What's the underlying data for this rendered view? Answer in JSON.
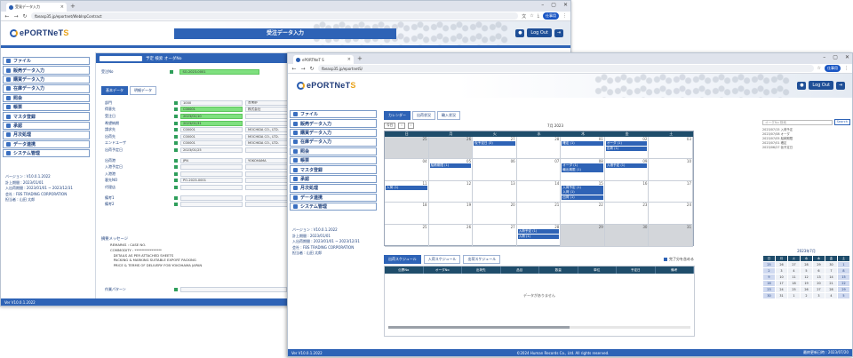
{
  "browser": {
    "tab1_title": "受発データ入力",
    "tab2_title": "ePORTNeT S",
    "url1": "fbeasp35.jp/eportnet/WebInpContract",
    "url2": "fbeasp35.jp/eportnetS/",
    "profile": "仕事用"
  },
  "brand": {
    "logo_main": "ePORTNeT",
    "logo_s": "S"
  },
  "window1": {
    "page_title": "受注データ入力",
    "logout": "Log Out",
    "sidebar": [
      "ファイル",
      "販売データ入力",
      "購買データ入力",
      "在庫データ入力",
      "照会",
      "帳票",
      "マスタ登録",
      "承認",
      "月次処理",
      "データ連携",
      "システム管理"
    ],
    "sidebar_info": [
      "バージョン : V10.0.1.2022",
      "計上期間 : 2023/01/01",
      "入出荷期間 : 2023/01/01 ~ 2023/12/31",
      "会社 : FBS TRADING CORPORATION",
      "担当者 : 山田 太郎"
    ],
    "search_bar": "予定  検索  オーダNo",
    "subtabs": [
      "基本データ",
      "明細データ"
    ],
    "order_label": "受注No",
    "order_value": "SO-2023-0001",
    "fields": [
      {
        "label": "部門",
        "value": "1000",
        "extra": "営業部"
      },
      {
        "label": "得意先",
        "value": "C00001",
        "extra": "株式会社"
      },
      {
        "label": "受注日",
        "value": "2023/01/10",
        "extra": ""
      },
      {
        "label": "希望納期",
        "value": "2023/01/31",
        "extra": ""
      },
      {
        "label": "請求先",
        "value": "C00001",
        "extra": "MOCHIDA CO., LTD."
      },
      {
        "label": "出荷先",
        "value": "C00001",
        "extra": "MOCHIDA CO., LTD."
      },
      {
        "label": "エンドユーザ",
        "value": "C00001",
        "extra": "MOCHIDA CO., LTD."
      },
      {
        "label": "出荷予定日",
        "value": "2023/01/25",
        "extra": ""
      },
      {
        "label": "出荷港",
        "value": "JPN",
        "extra": "YOKOHAMA"
      },
      {
        "label": "入港予定日",
        "value": "",
        "extra": ""
      },
      {
        "label": "入港港",
        "value": "",
        "extra": ""
      },
      {
        "label": "客先NO",
        "value": "PO-2023-0001",
        "extra": ""
      },
      {
        "label": "代理店",
        "value": "",
        "extra": ""
      },
      {
        "label": "備考1",
        "value": "",
        "extra": ""
      },
      {
        "label": "備考2",
        "value": "",
        "extra": ""
      }
    ],
    "remarks_label": "摘要メッセージ",
    "remarks": "REMARKS : CASE NO.\nCOMMODITY : ****************\n   DETAILS AS PER ATTACHED SHEETS\n   PACKING & MARKING SUITABLE EXPORT PACKING\n   PRICE & TERMS OF DELIVERY FOB YOKOHAMA JAPAN",
    "work_pattern": "作業パターン",
    "footer_left": "Ver V10.0.1.2022",
    "footer_right": "©2024 Human Records Co., Ltd. All rights reserved."
  },
  "window2": {
    "logout": "Log Out",
    "sidebar": [
      "ファイル",
      "販売データ入力",
      "購買データ入力",
      "在庫データ入力",
      "照会",
      "帳票",
      "マスタ登録",
      "承認",
      "月次処理",
      "データ連携",
      "システム管理"
    ],
    "sidebar_info": [
      "バージョン : V10.0.1.2022",
      "計上期間 : 2023/01/01",
      "入出荷期間 : 2023/01/01 ~ 2023/12/31",
      "会社 : FBS TRADING CORPORATION",
      "担当者 : 山田 太郎"
    ],
    "cal_tabs": [
      "カレンダー",
      "出荷状況",
      "輸入状況"
    ],
    "month_label": "7月 2023",
    "today_btn": "今日",
    "weekdays": [
      "日",
      "月",
      "火",
      "水",
      "木",
      "金",
      "土"
    ],
    "cells": [
      {
        "d": "25",
        "grey": true,
        "ev": []
      },
      {
        "d": "26",
        "grey": true,
        "ev": []
      },
      {
        "d": "27",
        "grey": false,
        "ev": [
          "仮予定日 (3)"
        ]
      },
      {
        "d": "28",
        "grey": false,
        "ev": []
      },
      {
        "d": "01",
        "grey": false,
        "ev": [
          "確定 (1)"
        ]
      },
      {
        "d": "02",
        "grey": false,
        "ev": [
          "オーダ (1)",
          "出荷 (1)"
        ]
      },
      {
        "d": "03",
        "grey": false,
        "ev": []
      },
      {
        "d": "04",
        "grey": false,
        "ev": []
      },
      {
        "d": "05",
        "grey": false,
        "ev": [
          "船積期限 (1)"
        ]
      },
      {
        "d": "06",
        "grey": false,
        "ev": []
      },
      {
        "d": "07",
        "grey": false,
        "ev": []
      },
      {
        "d": "08",
        "grey": false,
        "ev": [
          "オーダ (1)",
          "輸出期限 (1)"
        ]
      },
      {
        "d": "09",
        "grey": false,
        "ev": [
          "入港予定 (1)"
        ]
      },
      {
        "d": "10",
        "grey": false,
        "ev": []
      },
      {
        "d": "11",
        "grey": false,
        "ev": [
          "入荷 (1)"
        ]
      },
      {
        "d": "12",
        "grey": false,
        "ev": []
      },
      {
        "d": "13",
        "grey": false,
        "ev": []
      },
      {
        "d": "14",
        "grey": false,
        "ev": []
      },
      {
        "d": "15",
        "grey": false,
        "ev": [
          "入荷予定 (1)",
          "入荷 (1)",
          "出荷 (1)"
        ]
      },
      {
        "d": "16",
        "grey": false,
        "ev": []
      },
      {
        "d": "17",
        "grey": false,
        "ev": []
      },
      {
        "d": "18",
        "grey": false,
        "ev": []
      },
      {
        "d": "19",
        "grey": false,
        "ev": []
      },
      {
        "d": "20",
        "grey": false,
        "ev": []
      },
      {
        "d": "21",
        "grey": false,
        "ev": []
      },
      {
        "d": "22",
        "grey": false,
        "ev": []
      },
      {
        "d": "23",
        "grey": false,
        "ev": []
      },
      {
        "d": "24",
        "grey": false,
        "ev": []
      },
      {
        "d": "25",
        "grey": false,
        "ev": []
      },
      {
        "d": "26",
        "grey": false,
        "ev": []
      },
      {
        "d": "27",
        "grey": false,
        "ev": []
      },
      {
        "d": "28",
        "grey": false,
        "ev": [
          "入荷予定 (1)",
          "入荷 (1)"
        ]
      },
      {
        "d": "29",
        "grey": true,
        "ev": []
      },
      {
        "d": "30",
        "grey": true,
        "ev": []
      },
      {
        "d": "31",
        "grey": true,
        "ev": []
      }
    ],
    "search_placeholder": "オーダNo 検索",
    "search_btn": "Search",
    "search_results": [
      "2023/07/15 入荷予定",
      "2023/07/08 オーダ",
      "2023/07/05 船積期限",
      "2023/07/01 確定",
      "2023/06/27 仮予定日"
    ],
    "buttons": [
      "出荷スケジュール",
      "入荷スケジュール",
      "出荷スケジュール"
    ],
    "checkbox_label": "完了分を含める",
    "table_headers": [
      "伝票No",
      "オーダNo",
      "出荷先",
      "品目",
      "数量",
      "単位",
      "予定日",
      "備考"
    ],
    "table_empty": "データがありません",
    "footer_left": "Ver V10.0.1.2022",
    "footer_mid": "©2024 Human Records Co., Ltd. All rights reserved.",
    "footer_right": "最終更新日時 : 2023/07/20",
    "mini_title": "2023年7月",
    "mini_days": [
      "日",
      "月",
      "火",
      "水",
      "木",
      "金",
      "土"
    ],
    "mini_dates": [
      "25",
      "26",
      "27",
      "28",
      "29",
      "30",
      "1",
      "2",
      "3",
      "4",
      "5",
      "6",
      "7",
      "8",
      "9",
      "10",
      "11",
      "12",
      "13",
      "14",
      "15",
      "16",
      "17",
      "18",
      "19",
      "20",
      "21",
      "22",
      "23",
      "24",
      "25",
      "26",
      "27",
      "28",
      "29",
      "30",
      "31",
      "1",
      "2",
      "3",
      "4",
      "5"
    ]
  }
}
